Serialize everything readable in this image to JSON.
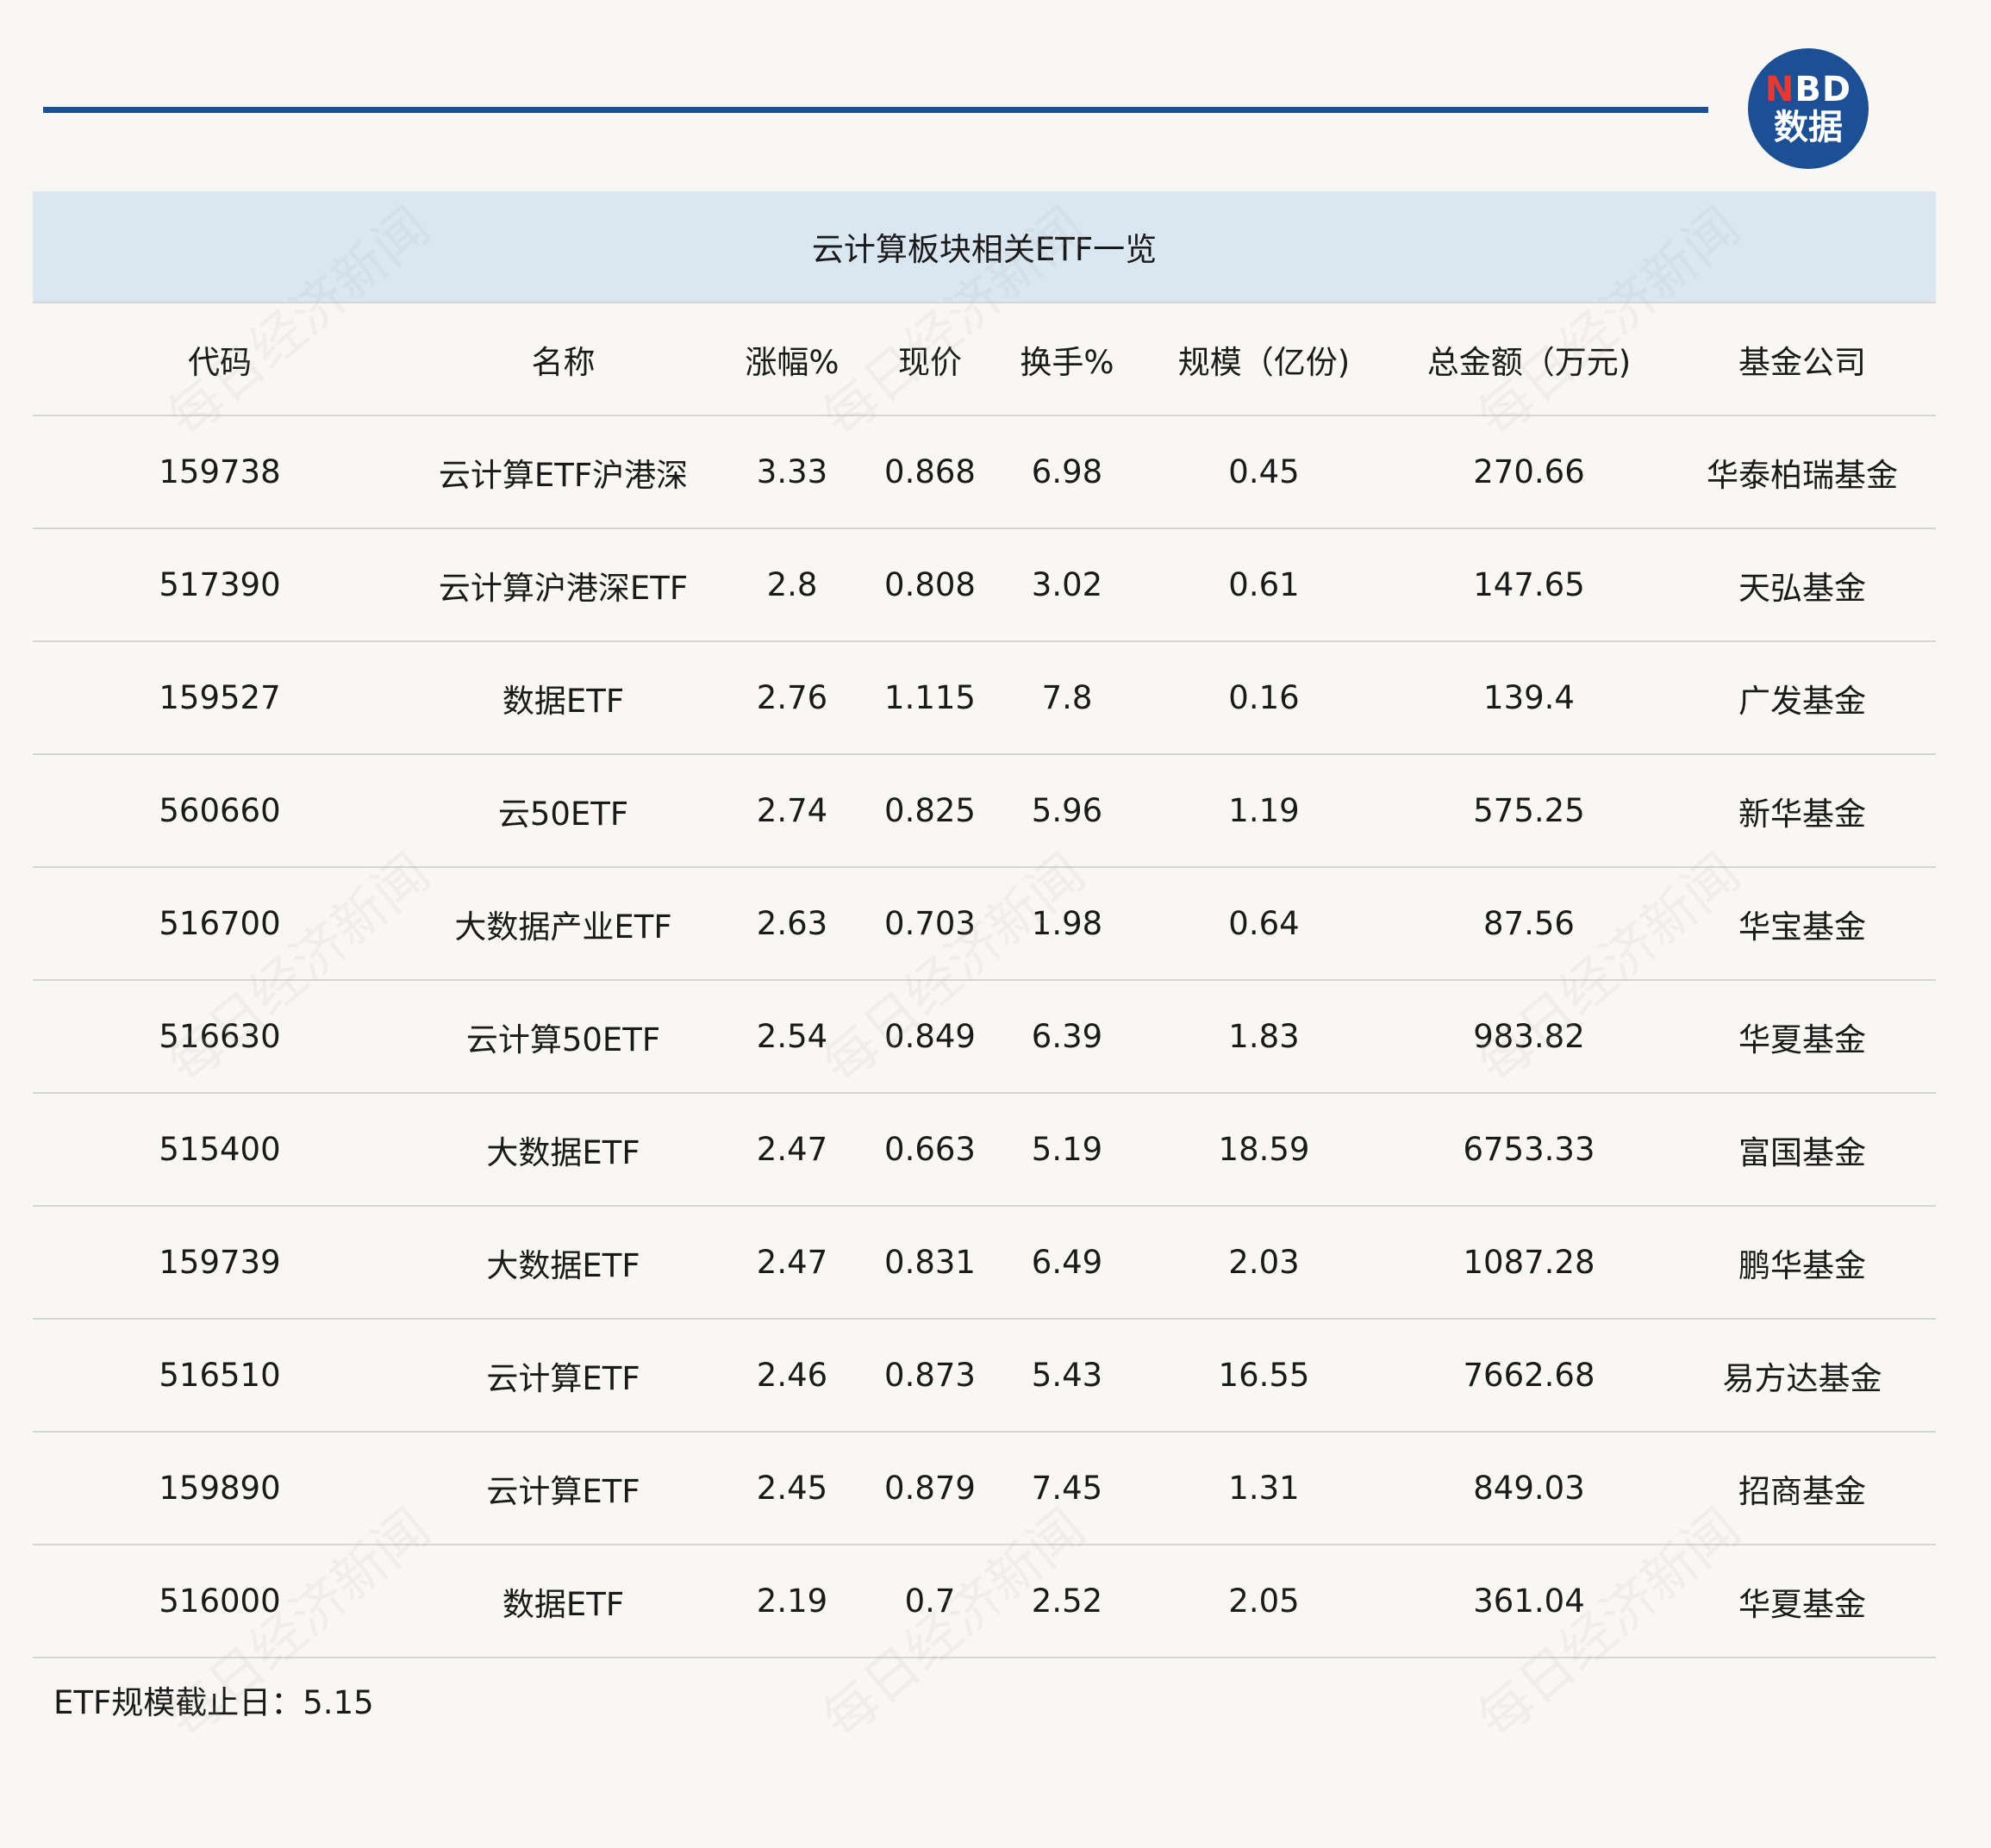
{
  "logo": {
    "n": "N",
    "bd": "BD",
    "cn": "数据"
  },
  "title": "云计算板块相关ETF一览",
  "headers": [
    "代码",
    "名称",
    "涨幅%",
    "现价",
    "换手%",
    "规模（亿份)",
    "总金额（万元)",
    "基金公司"
  ],
  "rows": [
    [
      "159738",
      "云计算ETF沪港深",
      "3.33",
      "0.868",
      "6.98",
      "0.45",
      "270.66",
      "华泰柏瑞基金"
    ],
    [
      "517390",
      "云计算沪港深ETF",
      "2.8",
      "0.808",
      "3.02",
      "0.61",
      "147.65",
      "天弘基金"
    ],
    [
      "159527",
      "数据ETF",
      "2.76",
      "1.115",
      "7.8",
      "0.16",
      "139.4",
      "广发基金"
    ],
    [
      "560660",
      "云50ETF",
      "2.74",
      "0.825",
      "5.96",
      "1.19",
      "575.25",
      "新华基金"
    ],
    [
      "516700",
      "大数据产业ETF",
      "2.63",
      "0.703",
      "1.98",
      "0.64",
      "87.56",
      "华宝基金"
    ],
    [
      "516630",
      "云计算50ETF",
      "2.54",
      "0.849",
      "6.39",
      "1.83",
      "983.82",
      "华夏基金"
    ],
    [
      "515400",
      "大数据ETF",
      "2.47",
      "0.663",
      "5.19",
      "18.59",
      "6753.33",
      "富国基金"
    ],
    [
      "159739",
      "大数据ETF",
      "2.47",
      "0.831",
      "6.49",
      "2.03",
      "1087.28",
      "鹏华基金"
    ],
    [
      "516510",
      "云计算ETF",
      "2.46",
      "0.873",
      "5.43",
      "16.55",
      "7662.68",
      "易方达基金"
    ],
    [
      "159890",
      "云计算ETF",
      "2.45",
      "0.879",
      "7.45",
      "1.31",
      "849.03",
      "招商基金"
    ],
    [
      "516000",
      "数据ETF",
      "2.19",
      "0.7",
      "2.52",
      "2.05",
      "361.04",
      "华夏基金"
    ]
  ],
  "note": "ETF规模截止日：5.15",
  "watermark": "每日经济新闻",
  "colors": {
    "accent": "#1c4f93",
    "title_band": "#dae6f0",
    "background": "#f9f7f3",
    "logo_n": "#e53935"
  }
}
